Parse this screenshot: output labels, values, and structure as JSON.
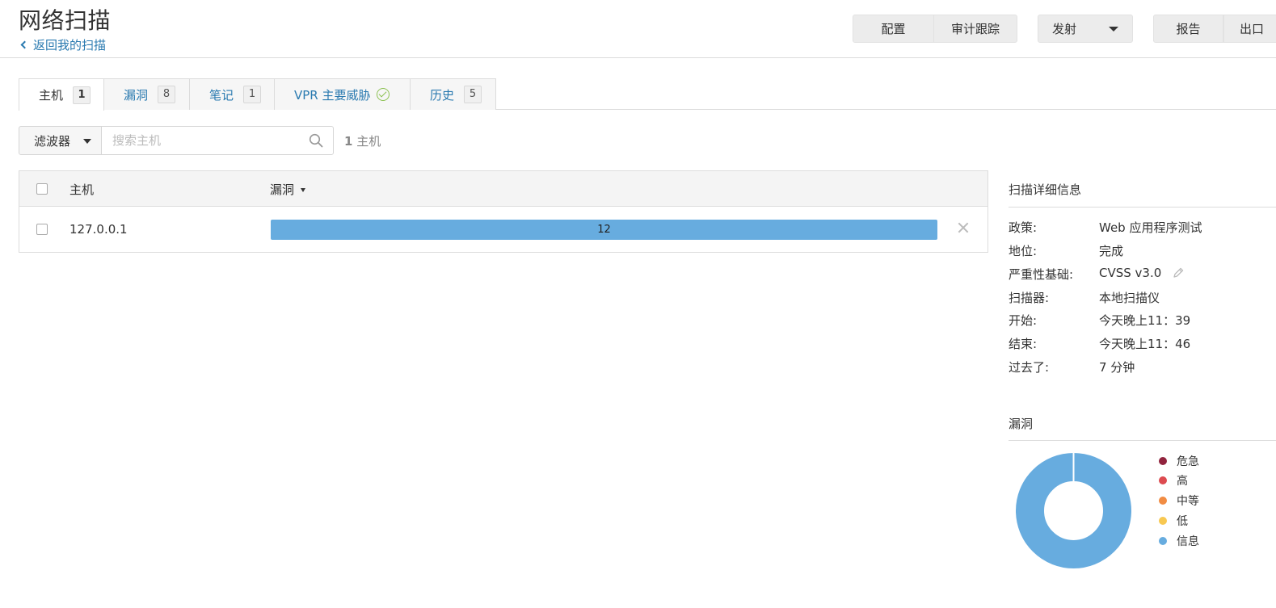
{
  "header": {
    "title": "网络扫描",
    "back_link": "返回我的扫描",
    "buttons": {
      "config": "配置",
      "audit": "审计跟踪",
      "launch": "发射",
      "report": "报告",
      "export": "出口"
    }
  },
  "tabs": [
    {
      "label": "主机",
      "count": "1"
    },
    {
      "label": "漏洞",
      "count": "8"
    },
    {
      "label": "笔记",
      "count": "1"
    },
    {
      "label": "VPR 主要威胁"
    },
    {
      "label": "历史",
      "count": "5"
    }
  ],
  "toolbar": {
    "filter_label": "滤波器",
    "search_placeholder": "搜索主机",
    "host_count_number": "1",
    "host_count_label": "主机"
  },
  "table": {
    "columns": [
      "主机",
      "漏洞"
    ],
    "rows": [
      {
        "host": "127.0.0.1",
        "vuln_count": "12"
      }
    ]
  },
  "scan_details": {
    "title": "扫描详细信息",
    "items": [
      {
        "label": "政策:",
        "value": "Web 应用程序测试"
      },
      {
        "label": "地位:",
        "value": "完成"
      },
      {
        "label": "严重性基础:",
        "value": "CVSS v3.0"
      },
      {
        "label": "扫描器:",
        "value": "本地扫描仪"
      },
      {
        "label": "开始:",
        "value": "今天晚上11：39"
      },
      {
        "label": "结束:",
        "value": "今天晚上11：46"
      },
      {
        "label": "过去了:",
        "value": "7 分钟"
      }
    ]
  },
  "vuln_chart": {
    "title": "漏洞",
    "legend": [
      {
        "label": "危急",
        "color": "#91243e"
      },
      {
        "label": "高",
        "color": "#dd4b50"
      },
      {
        "label": "中等",
        "color": "#f18c43"
      },
      {
        "label": "低",
        "color": "#f8c851"
      },
      {
        "label": "信息",
        "color": "#67acdf"
      }
    ]
  },
  "colors": {
    "link": "#2a7ab0",
    "bar": "#67acdf",
    "info": "#67acdf"
  }
}
